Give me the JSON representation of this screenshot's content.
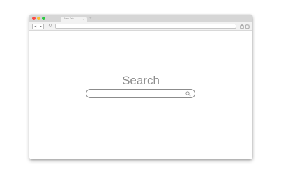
{
  "window": {
    "controls": {
      "close_color": "#fc4a45",
      "minimize_color": "#fdbc2e",
      "maximize_color": "#29c840"
    },
    "tab": {
      "title": "New Tab",
      "close_glyph": "×"
    },
    "new_tab_glyph": "+"
  },
  "toolbar": {
    "back_glyph": "◀",
    "forward_glyph": "▶",
    "reload_glyph": "↻",
    "address_value": "",
    "icons": [
      "share-icon",
      "tabs-icon"
    ]
  },
  "page": {
    "title": "Search",
    "search": {
      "value": "",
      "icon": "search-icon"
    }
  }
}
